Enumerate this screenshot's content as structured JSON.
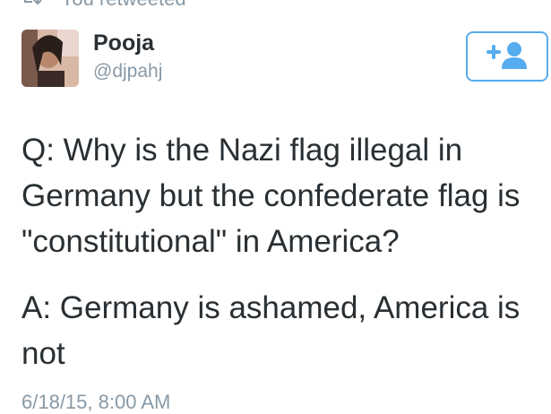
{
  "retweet": {
    "icon": "retweet-icon",
    "text": "You retweeted"
  },
  "user": {
    "name": "Pooja",
    "handle": "@djpahj",
    "avatar_icon": "avatar"
  },
  "follow_button": {
    "icon": "follow-user-icon",
    "accent": "#55acee"
  },
  "tweet": {
    "question": "Q: Why is the Nazi flag illegal in Germany but the confederate flag is \"constitutional\" in America?",
    "answer": "A: Germany is ashamed, America is not"
  },
  "timestamp": "6/18/15, 8:00 AM"
}
